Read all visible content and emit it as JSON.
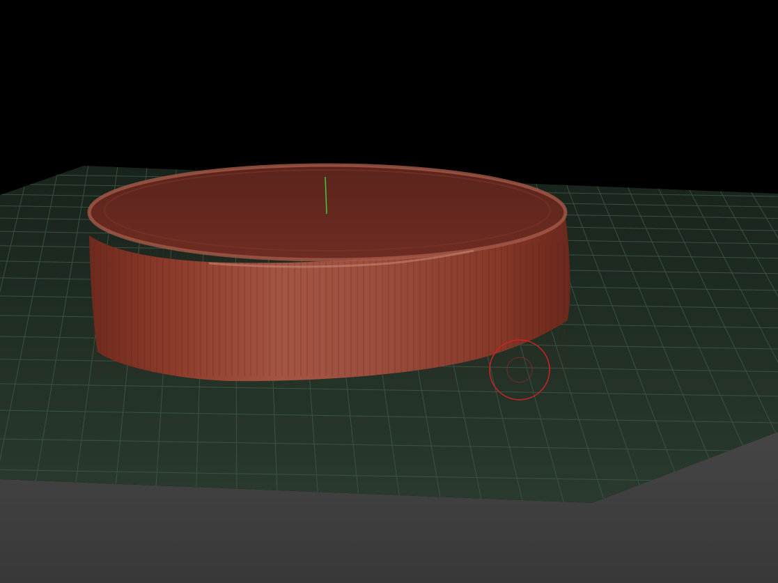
{
  "viewport": {
    "background_color": "#000000",
    "floor_grid_color": "#3e5a47",
    "floor_color": "#223226",
    "lower_floor_color": "#3c3c3c",
    "mesh_color": "#8a3a2c",
    "mesh_highlight_color": "#b86a58",
    "cursor_color": "#d22222",
    "axis_color": "#3ccc3c"
  },
  "icons": {
    "brush_cursor": "brush-cursor-icon",
    "axis_gizmo": "axis-gizmo-icon"
  }
}
